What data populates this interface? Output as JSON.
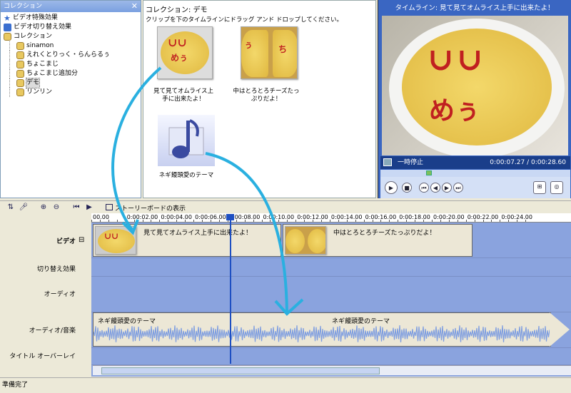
{
  "collections_pane": {
    "title": "コレクション",
    "items": [
      {
        "label": "ビデオ特殊効果",
        "icon": "star-icon",
        "indent": 0
      },
      {
        "label": "ビデオ切り替え効果",
        "icon": "transition-icon",
        "indent": 0
      },
      {
        "label": "コレクション",
        "icon": "collection-folder-icon",
        "indent": 0
      },
      {
        "label": "sinamon",
        "icon": "collection-folder-icon",
        "indent": 1
      },
      {
        "label": "えれくとりっく・らんらるぅ",
        "icon": "collection-folder-icon",
        "indent": 1
      },
      {
        "label": "ちょこまじ",
        "icon": "collection-folder-icon",
        "indent": 1
      },
      {
        "label": "ちょこまじ追加分",
        "icon": "collection-folder-icon",
        "indent": 1
      },
      {
        "label": "デモ",
        "icon": "collection-folder-icon",
        "indent": 1,
        "selected": true
      },
      {
        "label": "リンリン",
        "icon": "collection-folder-icon",
        "indent": 1
      }
    ]
  },
  "content_pane": {
    "title": "コレクション: デモ",
    "subtitle": "クリップを下のタイムラインにドラッグ アンド ドロップしてください。",
    "clips": [
      {
        "label": "見て見てオムライス上手に出来たよ！"
      },
      {
        "label": "中はとろとろチーズたっぷりだよ！"
      },
      {
        "label": "ネギ饅頭愛のテーマ"
      }
    ]
  },
  "preview": {
    "title": "タイムライン: 見て見てオムライス上手に出来たよ！",
    "status": "一時停止",
    "time": "0:00:07.27 / 0:00:28.60",
    "seek_fraction": 0.25
  },
  "timeline": {
    "storyboard_label": "ストーリーボードの表示",
    "ruler": [
      "00.00",
      "0:00:02.00",
      "0:00:04.00",
      "0:00:06.00",
      "0:00:08.00",
      "0:00:10.00",
      "0:00:12.00",
      "0:00:14.00",
      "0:00:16.00",
      "0:00:18.00",
      "0:00:20.00",
      "0:00:22.00",
      "0:00:24.00"
    ],
    "tracks": {
      "video": "ビデオ",
      "transition": "切り替え効果",
      "audio": "オーディオ",
      "audio_music": "オーディオ/音楽",
      "title_overlay": "タイトル オーバーレイ"
    },
    "video_clips": [
      "見て見てオムライス上手に出来たよ！",
      "中はとろとろチーズたっぷりだよ！"
    ],
    "audio_clip_label": "ネギ饅頭愛のテーマ",
    "expand_symbol": "⊟"
  },
  "status_bar": "準備完了",
  "colors": {
    "annotation_arrow": "#2ab0e0",
    "track_bg": "#8aa3de",
    "playhead": "#1e4fc2"
  }
}
